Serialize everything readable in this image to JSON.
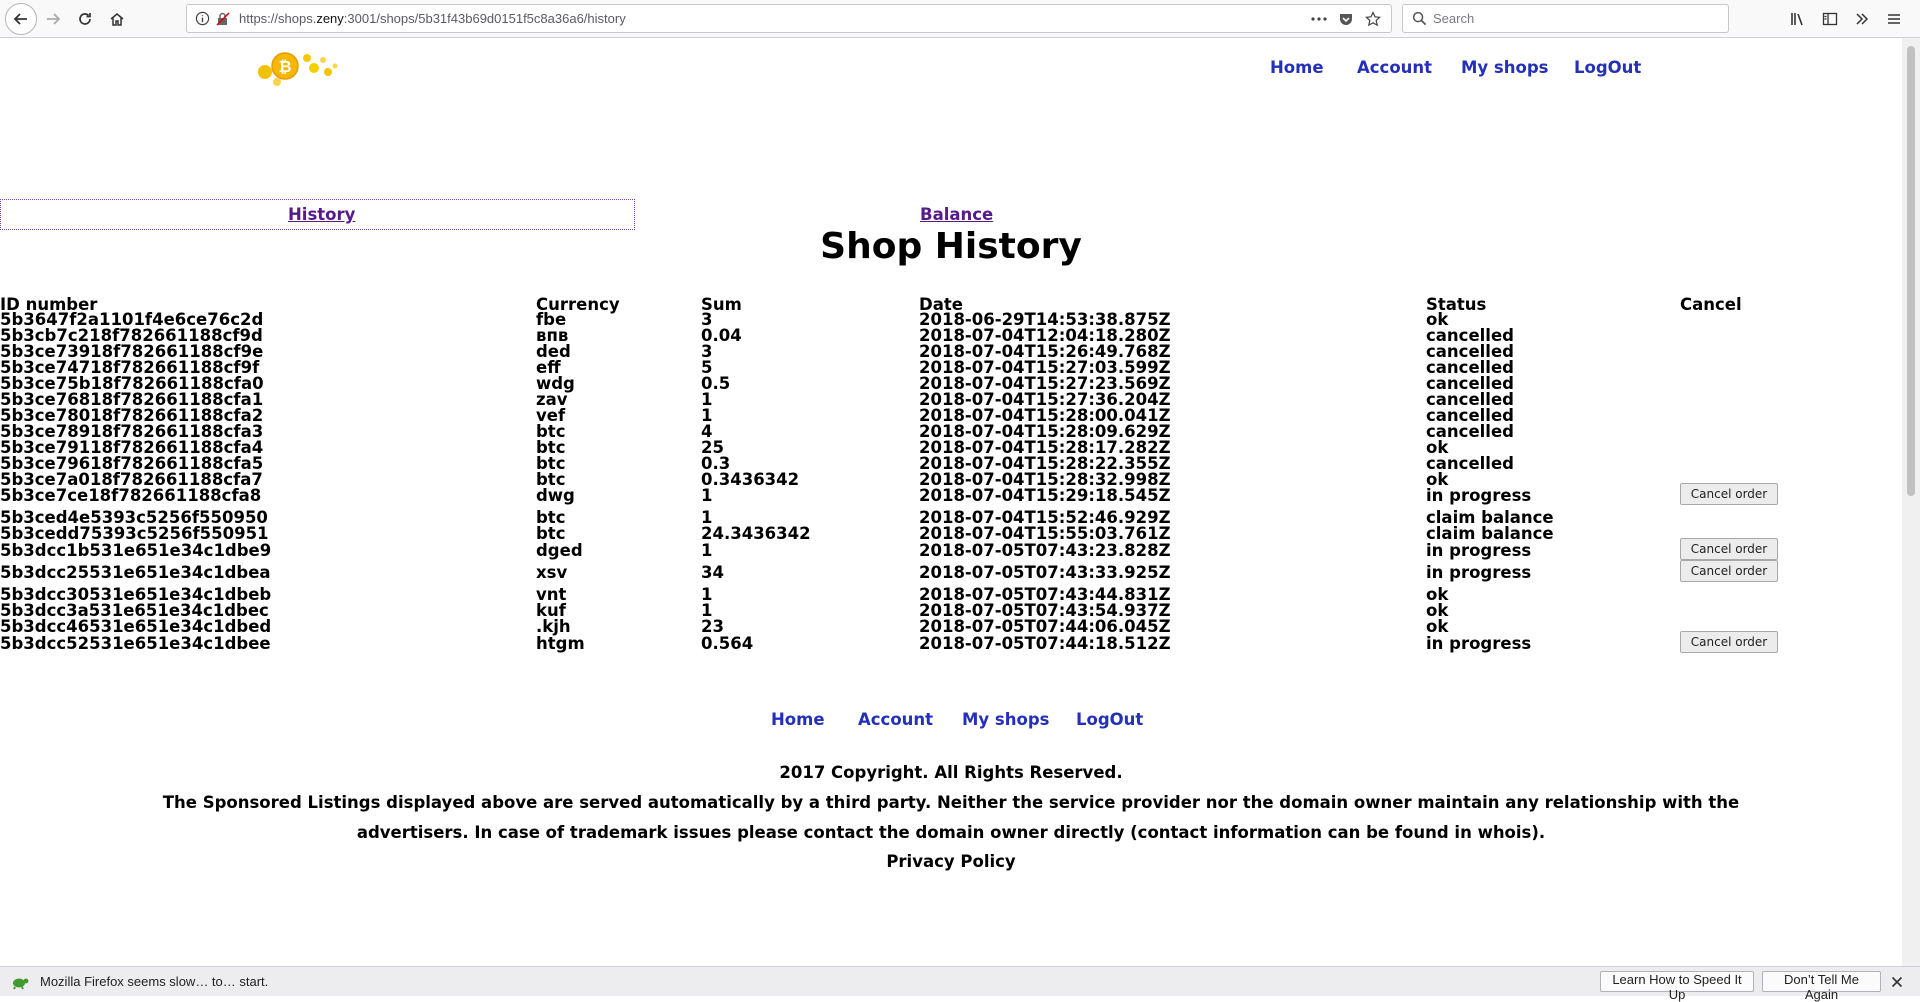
{
  "browser": {
    "url_prefix": "https://shops.",
    "url_host": "zeny",
    "url_suffix": ":3001/shops/5b31f43b69d0151f5c8a36a6/history",
    "search_placeholder": "Search"
  },
  "nav": {
    "home": "Home",
    "account": "Account",
    "my_shops": "My shops",
    "logout": "LogOut"
  },
  "tabs": {
    "history": "History",
    "balance": "Balance"
  },
  "title": "Shop History",
  "table": {
    "headers": {
      "id": "ID number",
      "currency": "Currency",
      "sum": "Sum",
      "date": "Date",
      "status": "Status",
      "cancel": "Cancel"
    },
    "cancel_label": "Cancel order",
    "rows": [
      {
        "id": "5b3647f2a1101f4e6ce76c2d",
        "currency": "fbe",
        "sum": "3",
        "date": "2018-06-29T14:53:38.875Z",
        "status": "ok"
      },
      {
        "id": "5b3cb7c218f782661188cf9d",
        "currency": "впв",
        "sum": "0.04",
        "date": "2018-07-04T12:04:18.280Z",
        "status": "cancelled"
      },
      {
        "id": "5b3ce73918f782661188cf9e",
        "currency": "ded",
        "sum": "3",
        "date": "2018-07-04T15:26:49.768Z",
        "status": "cancelled"
      },
      {
        "id": "5b3ce74718f782661188cf9f",
        "currency": "eff",
        "sum": "5",
        "date": "2018-07-04T15:27:03.599Z",
        "status": "cancelled"
      },
      {
        "id": "5b3ce75b18f782661188cfa0",
        "currency": "wdg",
        "sum": "0.5",
        "date": "2018-07-04T15:27:23.569Z",
        "status": "cancelled"
      },
      {
        "id": "5b3ce76818f782661188cfa1",
        "currency": "zav",
        "sum": "1",
        "date": "2018-07-04T15:27:36.204Z",
        "status": "cancelled"
      },
      {
        "id": "5b3ce78018f782661188cfa2",
        "currency": "vef",
        "sum": "1",
        "date": "2018-07-04T15:28:00.041Z",
        "status": "cancelled"
      },
      {
        "id": "5b3ce78918f782661188cfa3",
        "currency": "btc",
        "sum": "4",
        "date": "2018-07-04T15:28:09.629Z",
        "status": "cancelled"
      },
      {
        "id": "5b3ce79118f782661188cfa4",
        "currency": "btc",
        "sum": "25",
        "date": "2018-07-04T15:28:17.282Z",
        "status": "ok"
      },
      {
        "id": "5b3ce79618f782661188cfa5",
        "currency": "btc",
        "sum": "0.3",
        "date": "2018-07-04T15:28:22.355Z",
        "status": "cancelled"
      },
      {
        "id": "5b3ce7a018f782661188cfa7",
        "currency": "btc",
        "sum": "0.3436342",
        "date": "2018-07-04T15:28:32.998Z",
        "status": "ok"
      },
      {
        "id": "5b3ce7ce18f782661188cfa8",
        "currency": "dwg",
        "sum": "1",
        "date": "2018-07-04T15:29:18.545Z",
        "status": "in progress",
        "cancel": true
      },
      {
        "id": "5b3ced4e5393c5256f550950",
        "currency": "btc",
        "sum": "1",
        "date": "2018-07-04T15:52:46.929Z",
        "status": "claim balance"
      },
      {
        "id": "5b3cedd75393c5256f550951",
        "currency": "btc",
        "sum": "24.3436342",
        "date": "2018-07-04T15:55:03.761Z",
        "status": "claim balance"
      },
      {
        "id": "5b3dcc1b531e651e34c1dbe9",
        "currency": "dged",
        "sum": "1",
        "date": "2018-07-05T07:43:23.828Z",
        "status": "in progress",
        "cancel": true
      },
      {
        "id": "5b3dcc25531e651e34c1dbea",
        "currency": "xsv",
        "sum": "34",
        "date": "2018-07-05T07:43:33.925Z",
        "status": "in progress",
        "cancel": true
      },
      {
        "id": "5b3dcc30531e651e34c1dbeb",
        "currency": "vnt",
        "sum": "1",
        "date": "2018-07-05T07:43:44.831Z",
        "status": "ok"
      },
      {
        "id": "5b3dcc3a531e651e34c1dbec",
        "currency": "kuf",
        "sum": "1",
        "date": "2018-07-05T07:43:54.937Z",
        "status": "ok"
      },
      {
        "id": "5b3dcc46531e651e34c1dbed",
        "currency": ".kjh",
        "sum": "23",
        "date": "2018-07-05T07:44:06.045Z",
        "status": "ok"
      },
      {
        "id": "5b3dcc52531e651e34c1dbee",
        "currency": "htgm",
        "sum": "0.564",
        "date": "2018-07-05T07:44:18.512Z",
        "status": "in progress",
        "cancel": true
      }
    ]
  },
  "footer": {
    "copyright": "2017 Copyright. All Rights Reserved.",
    "disclaimer_1": "The Sponsored Listings displayed above are served automatically by a third party. Neither the service provider nor the domain owner maintain any relationship with the",
    "disclaimer_2": "advertisers. In case of trademark issues please contact the domain owner directly (contact information can be found in whois).",
    "privacy": "Privacy Policy"
  },
  "notification": {
    "message": "Mozilla Firefox seems slow… to… start.",
    "learn_button": "Learn How to Speed It Up",
    "dismiss_button": "Don’t Tell Me Again"
  }
}
